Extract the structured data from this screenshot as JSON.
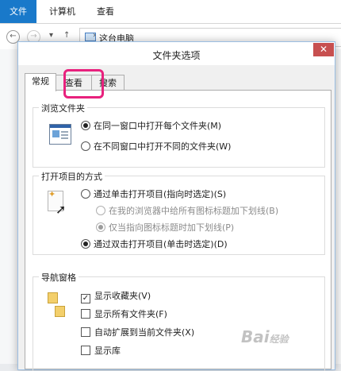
{
  "explorer": {
    "ribbon_tabs": {
      "file": "文件",
      "computer": "计算机",
      "view": "查看"
    },
    "address": "这台电脑",
    "nav_up": "↑",
    "nav_chevron": "›"
  },
  "dialog": {
    "title": "文件夹选项",
    "close": "✕",
    "tabs": {
      "general": "常规",
      "view": "查看",
      "search": "搜索"
    },
    "browse_group": {
      "title": "浏览文件夹",
      "same_window": "在同一窗口中打开每个文件夹(M)",
      "new_window": "在不同窗口中打开不同的文件夹(W)"
    },
    "open_group": {
      "title": "打开项目的方式",
      "single_click": "通过单击打开项目(指向时选定)(S)",
      "underline_browser": "在我的浏览器中给所有图标标题加下划线(B)",
      "underline_hover": "仅当指向图标标题时加下划线(P)",
      "double_click": "通过双击打开项目(单击时选定)(D)"
    },
    "nav_group": {
      "title": "导航窗格",
      "show_favorites": "显示收藏夹(V)",
      "show_all_folders": "显示所有文件夹(F)",
      "auto_expand": "自动扩展到当前文件夹(X)",
      "show_libraries": "显示库"
    }
  },
  "watermark": {
    "main": "Bai",
    "sub": "经验"
  }
}
